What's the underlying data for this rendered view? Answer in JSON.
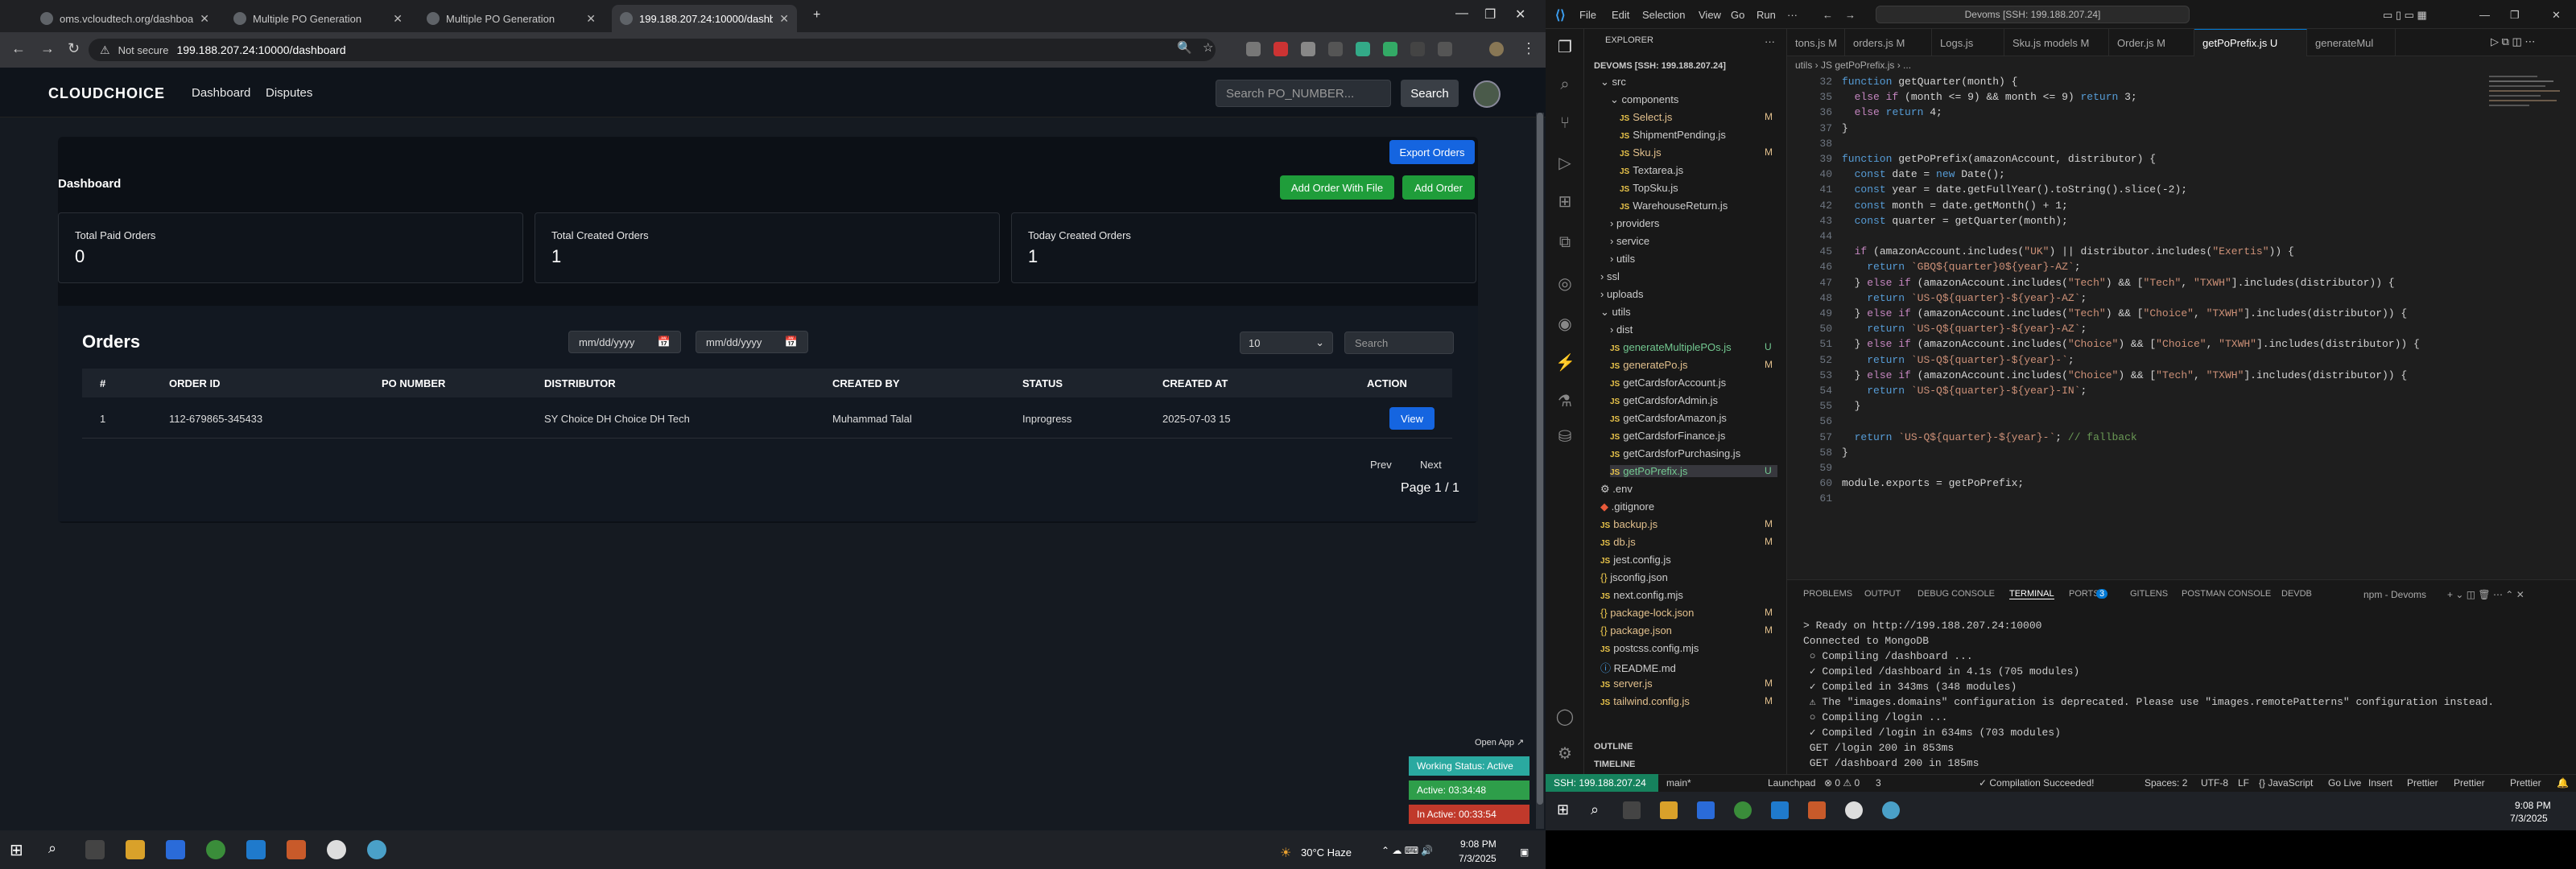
{
  "browser": {
    "tabs": [
      {
        "title": "oms.vcloudtech.org/dashboard"
      },
      {
        "title": "Multiple PO Generation"
      },
      {
        "title": "Multiple PO Generation"
      },
      {
        "title": "199.188.207.24:10000/dashbo"
      }
    ],
    "not_secure": "Not secure",
    "url": "199.188.207.24:10000/dashboard"
  },
  "app": {
    "logo": "CLOUDCHOICE",
    "nav": [
      "Dashboard",
      "Disputes"
    ],
    "search_placeholder": "Search PO_NUMBER...",
    "search_button": "Search"
  },
  "dashboard": {
    "title": "Dashboard",
    "export_button": "Export Orders",
    "add_file_button": "Add Order With File",
    "add_order_button": "Add Order",
    "stats": [
      {
        "label": "Total Paid Orders",
        "value": "0"
      },
      {
        "label": "Total Created Orders",
        "value": "1"
      },
      {
        "label": "Today Created Orders",
        "value": "1"
      }
    ]
  },
  "orders": {
    "title": "Orders",
    "date_from_placeholder": "mm/dd/yyyy",
    "date_to_placeholder": "mm/dd/yyyy",
    "page_size": "10",
    "search_placeholder": "Search",
    "columns": [
      "#",
      "ORDER ID",
      "PO NUMBER",
      "DISTRIBUTOR",
      "CREATED BY",
      "STATUS",
      "CREATED AT",
      "ACTION"
    ],
    "rows": [
      {
        "num": "1",
        "order_id": "112-679865-345433",
        "po_number": "",
        "distributor": "SY Choice DH Choice DH Tech",
        "created_by": "Muhammad Talal",
        "status": "Inprogress",
        "created_at": "2025-07-03 15",
        "action": "View"
      }
    ],
    "prev": "Prev",
    "next": "Next",
    "page_info": "Page 1 / 1"
  },
  "widget": {
    "open_app": "Open App ↗",
    "working": "Working Status: Active",
    "active": "Active: 03:34:48",
    "inactive": "In Active: 00:33:54"
  },
  "taskbar_left": {
    "weather": "30°C Haze",
    "time": "9:08 PM",
    "date": "7/3/2025"
  },
  "vscode": {
    "menu": [
      "File",
      "Edit",
      "Selection",
      "View",
      "Go",
      "Run",
      "···"
    ],
    "search": "Devoms [SSH: 199.188.207.24]",
    "explorer_title": "EXPLORER",
    "workspace": "DEVOMS [SSH: 199.188.207.24]",
    "tree": [
      {
        "name": "src",
        "kind": "folder",
        "mark": ""
      },
      {
        "name": "components",
        "kind": "folder",
        "mark": ""
      },
      {
        "name": "Select.js",
        "kind": "js",
        "mark": "M"
      },
      {
        "name": "ShipmentPending.js",
        "kind": "js",
        "mark": ""
      },
      {
        "name": "Sku.js",
        "kind": "js",
        "mark": "M"
      },
      {
        "name": "Textarea.js",
        "kind": "js",
        "mark": ""
      },
      {
        "name": "TopSku.js",
        "kind": "js",
        "mark": ""
      },
      {
        "name": "WarehouseReturn.js",
        "kind": "js",
        "mark": ""
      },
      {
        "name": "providers",
        "kind": "folder",
        "mark": ""
      },
      {
        "name": "service",
        "kind": "folder",
        "mark": ""
      },
      {
        "name": "utils",
        "kind": "folder",
        "mark": ""
      },
      {
        "name": "ssl",
        "kind": "folder",
        "mark": ""
      },
      {
        "name": "uploads",
        "kind": "folder",
        "mark": ""
      },
      {
        "name": "utils",
        "kind": "folder",
        "mark": ""
      },
      {
        "name": "dist",
        "kind": "folder",
        "mark": ""
      },
      {
        "name": "generateMultiplePOs.js",
        "kind": "js",
        "mark": "U"
      },
      {
        "name": "generatePo.js",
        "kind": "js",
        "mark": "M"
      },
      {
        "name": "getCardsforAccount.js",
        "kind": "js",
        "mark": ""
      },
      {
        "name": "getCardsforAdmin.js",
        "kind": "js",
        "mark": ""
      },
      {
        "name": "getCardsforAmazon.js",
        "kind": "js",
        "mark": ""
      },
      {
        "name": "getCardsforFinance.js",
        "kind": "js",
        "mark": ""
      },
      {
        "name": "getCardsforPurchasing.js",
        "kind": "js",
        "mark": ""
      },
      {
        "name": "getPoPrefix.js",
        "kind": "js",
        "mark": "U"
      },
      {
        "name": ".env",
        "kind": "env",
        "mark": ""
      },
      {
        "name": ".gitignore",
        "kind": "git",
        "mark": ""
      },
      {
        "name": "backup.js",
        "kind": "js",
        "mark": "M"
      },
      {
        "name": "db.js",
        "kind": "js",
        "mark": "M"
      },
      {
        "name": "jest.config.js",
        "kind": "js",
        "mark": ""
      },
      {
        "name": "jsconfig.json",
        "kind": "json",
        "mark": ""
      },
      {
        "name": "next.config.mjs",
        "kind": "js",
        "mark": ""
      },
      {
        "name": "package-lock.json",
        "kind": "json",
        "mark": "M"
      },
      {
        "name": "package.json",
        "kind": "json",
        "mark": "M"
      },
      {
        "name": "postcss.config.mjs",
        "kind": "js",
        "mark": ""
      },
      {
        "name": "README.md",
        "kind": "md",
        "mark": ""
      },
      {
        "name": "server.js",
        "kind": "js",
        "mark": "M"
      },
      {
        "name": "tailwind.config.js",
        "kind": "js",
        "mark": "M"
      }
    ],
    "outline": "OUTLINE",
    "timeline": "TIMELINE",
    "editor_tabs": [
      "tons.js M",
      "orders.js M",
      "Logs.js",
      "Sku.js models M",
      "Order.js M",
      "getPoPrefix.js U",
      "generateMul"
    ],
    "breadcrumb": "utils › JS getPoPrefix.js › ...",
    "code": [
      {
        "n": "32",
        "t": "function getQuarter(month) {"
      },
      {
        "n": "35",
        "t": "  else if (month <= 9) && month <= 9) return 3;"
      },
      {
        "n": "36",
        "t": "  else return 4;"
      },
      {
        "n": "37",
        "t": "}"
      },
      {
        "n": "38",
        "t": ""
      },
      {
        "n": "39",
        "t": "function getPoPrefix(amazonAccount, distributor) {"
      },
      {
        "n": "40",
        "t": "  const date = new Date();"
      },
      {
        "n": "41",
        "t": "  const year = date.getFullYear().toString().slice(-2);"
      },
      {
        "n": "42",
        "t": "  const month = date.getMonth() + 1;"
      },
      {
        "n": "43",
        "t": "  const quarter = getQuarter(month);"
      },
      {
        "n": "44",
        "t": ""
      },
      {
        "n": "45",
        "t": "  if (amazonAccount.includes(\"UK\") || distributor.includes(\"Exertis\")) {"
      },
      {
        "n": "46",
        "t": "    return `GBQ${quarter}0${year}-AZ`;"
      },
      {
        "n": "47",
        "t": "  } else if (amazonAccount.includes(\"Tech\") && [\"Tech\", \"TXWH\"].includes(distributor)) {"
      },
      {
        "n": "48",
        "t": "    return `US-Q${quarter}-${year}-AZ`;"
      },
      {
        "n": "49",
        "t": "  } else if (amazonAccount.includes(\"Tech\") && [\"Choice\", \"TXWH\"].includes(distributor)) {"
      },
      {
        "n": "50",
        "t": "    return `US-Q${quarter}-${year}-AZ`;"
      },
      {
        "n": "51",
        "t": "  } else if (amazonAccount.includes(\"Choice\") && [\"Choice\", \"TXWH\"].includes(distributor)) {"
      },
      {
        "n": "52",
        "t": "    return `US-Q${quarter}-${year}-`;"
      },
      {
        "n": "53",
        "t": "  } else if (amazonAccount.includes(\"Choice\") && [\"Tech\", \"TXWH\"].includes(distributor)) {"
      },
      {
        "n": "54",
        "t": "    return `US-Q${quarter}-${year}-IN`;"
      },
      {
        "n": "55",
        "t": "  }"
      },
      {
        "n": "56",
        "t": ""
      },
      {
        "n": "57",
        "t": "  return `US-Q${quarter}-${year}-`; // fallback"
      },
      {
        "n": "58",
        "t": "}"
      },
      {
        "n": "59",
        "t": ""
      },
      {
        "n": "60",
        "t": "module.exports = getPoPrefix;"
      },
      {
        "n": "61",
        "t": ""
      }
    ],
    "panel_tabs": [
      "PROBLEMS",
      "OUTPUT",
      "DEBUG CONSOLE",
      "TERMINAL",
      "PORTS",
      "GITLENS",
      "POSTMAN CONSOLE",
      "DEVDB"
    ],
    "ports_count": "3",
    "terminal_label": "npm - Devoms",
    "terminal": [
      "> Ready on http://199.188.207.24:10000",
      "Connected to MongoDB",
      " ○ Compiling /dashboard ...",
      " ✓ Compiled /dashboard in 4.1s (705 modules)",
      " ✓ Compiled in 343ms (348 modules)",
      " ⚠ The \"images.domains\" configuration is deprecated. Please use \"images.remotePatterns\" configuration instead.",
      " ○ Compiling /login ...",
      " ✓ Compiled /login in 634ms (703 modules)",
      " GET /login 200 in 853ms",
      " GET /dashboard 200 in 185ms"
    ],
    "status": {
      "remote": "SSH: 199.188.207.24",
      "branch": "main*",
      "launchpad": "Launchpad",
      "problems": "⊗ 0 ⚠ 0",
      "ports": "3",
      "compile": "✓ Compilation Succeeded!",
      "spaces": "Spaces: 2",
      "encoding": "UTF-8",
      "eol": "LF",
      "lang": "{} JavaScript",
      "golive": "Go Live",
      "insert": "Insert",
      "prettier1": "Prettier",
      "prettier2": "Prettier",
      "prettier3": "Prettier"
    },
    "taskbar_time": "9:08 PM",
    "taskbar_date": "7/3/2025"
  },
  "colors": {
    "blue": "#1565e0",
    "green": "#1f9d3a",
    "remote": "#16825d",
    "working": "#2aa9a0",
    "active_green": "#2e9e4a",
    "inactive_red": "#c0392b"
  }
}
